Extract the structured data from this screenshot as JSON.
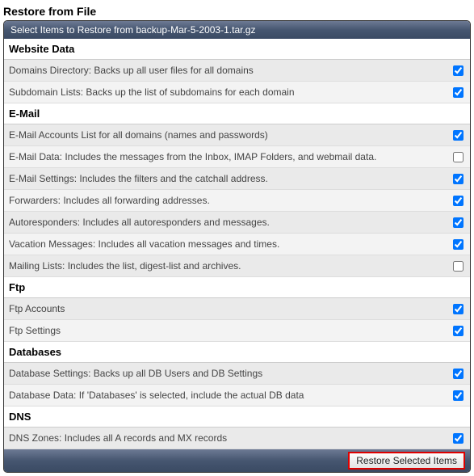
{
  "pageTitle": "Restore from File",
  "panelHeader": "Select Items to Restore from backup-Mar-5-2003-1.tar.gz",
  "sections": [
    {
      "title": "Website Data",
      "items": [
        {
          "label": "Domains Directory: Backs up all user files for all domains",
          "checked": true
        },
        {
          "label": "Subdomain Lists: Backs up the list of subdomains for each domain",
          "checked": true
        }
      ]
    },
    {
      "title": "E-Mail",
      "items": [
        {
          "label": "E-Mail Accounts List for all domains (names and passwords)",
          "checked": true
        },
        {
          "label": "E-Mail Data: Includes the messages from the Inbox, IMAP Folders, and webmail data.",
          "checked": false
        },
        {
          "label": "E-Mail Settings: Includes the filters and the catchall address.",
          "checked": true
        },
        {
          "label": "Forwarders: Includes all forwarding addresses.",
          "checked": true
        },
        {
          "label": "Autoresponders: Includes all autoresponders and messages.",
          "checked": true
        },
        {
          "label": "Vacation Messages: Includes all vacation messages and times.",
          "checked": true
        },
        {
          "label": "Mailing Lists: Includes the list, digest-list and archives.",
          "checked": false
        }
      ]
    },
    {
      "title": "Ftp",
      "items": [
        {
          "label": "Ftp Accounts",
          "checked": true
        },
        {
          "label": "Ftp Settings",
          "checked": true
        }
      ]
    },
    {
      "title": "Databases",
      "items": [
        {
          "label": "Database Settings: Backs up all DB Users and DB Settings",
          "checked": true
        },
        {
          "label": "Database Data: If 'Databases' is selected, include the actual DB data",
          "checked": true
        }
      ]
    },
    {
      "title": "DNS",
      "items": [
        {
          "label": "DNS Zones: Includes all A records and MX records",
          "checked": true
        }
      ]
    }
  ],
  "restoreButton": "Restore Selected Items"
}
